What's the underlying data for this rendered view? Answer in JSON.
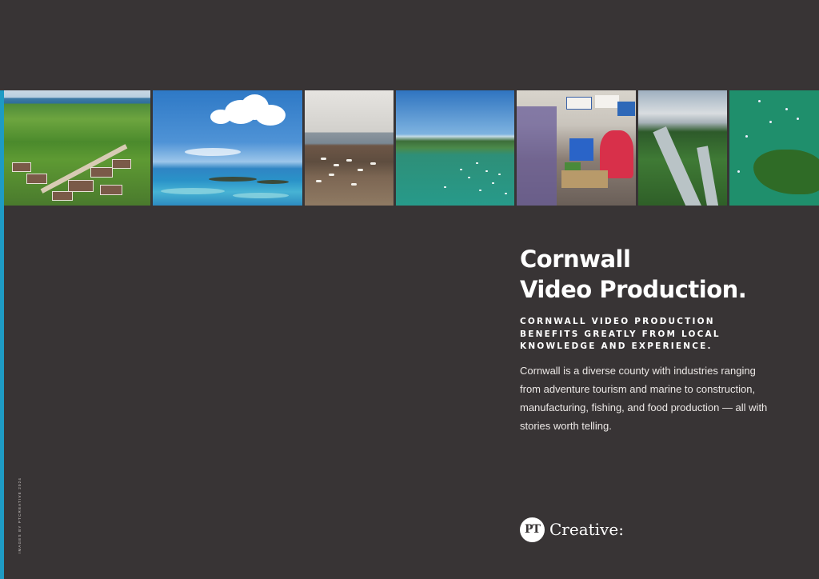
{
  "page": {
    "background_color": "#383435",
    "accent_color": "#1e9bc4"
  },
  "photos": [
    {
      "subject": "aerial countryside with houses"
    },
    {
      "subject": "sky and sea with islands"
    },
    {
      "subject": "harbour with boats"
    },
    {
      "subject": "estuary with moored boats"
    },
    {
      "subject": "exhibition booth"
    },
    {
      "subject": "wooded river valley"
    },
    {
      "subject": "coastal aerial with boats"
    }
  ],
  "heading": {
    "line1": "Cornwall",
    "line2": "Video Production."
  },
  "subheading": "CORNWALL VIDEO PRODUCTION BENEFITS GREATLY FROM LOCAL KNOWLEDGE AND EXPERIENCE.",
  "body": "Cornwall is a diverse county with industries ranging from adventure tourism and marine to construction, manufacturing, fishing, and food production — all with stories worth telling.",
  "logo": {
    "mark": "PT",
    "wordmark": "Creative:"
  },
  "credit": "IMAGES BY PTCREATIVE 2024"
}
